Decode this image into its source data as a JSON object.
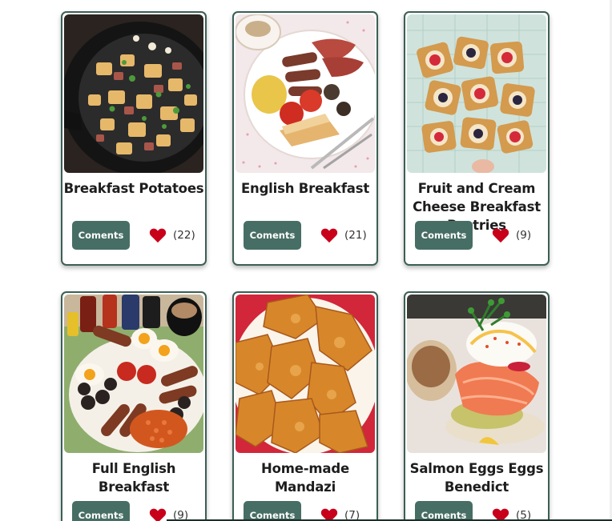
{
  "colors": {
    "card_border": "#3c5f56",
    "button_bg": "#476e64",
    "button_text": "#ffffff",
    "heart": "#c8001a"
  },
  "recipes": [
    {
      "title_lines": [
        "Breakfast Potatoes"
      ],
      "button_label": "Coments",
      "likes": "(22)",
      "image": "skillet-potatoes-photo"
    },
    {
      "title_lines": [
        "English Breakfast"
      ],
      "button_label": "Coments",
      "likes": "(21)",
      "image": "english-breakfast-plate-photo"
    },
    {
      "title_lines": [
        "Fruit and Cream",
        "Cheese Breakfast",
        "Pastries"
      ],
      "button_label": "Coments",
      "likes": "(9)",
      "image": "fruit-pastries-photo"
    },
    {
      "title_lines": [
        "Full English",
        "Breakfast"
      ],
      "button_label": "Coments",
      "likes": "(9)",
      "image": "full-english-breakfast-photo"
    },
    {
      "title_lines": [
        "Home-made",
        "Mandazi"
      ],
      "button_label": "Coments",
      "likes": "(7)",
      "image": "mandazi-photo"
    },
    {
      "title_lines": [
        "Salmon Eggs Eggs",
        "Benedict"
      ],
      "button_label": "Coments",
      "likes": "(5)",
      "image": "salmon-eggs-benedict-photo"
    }
  ]
}
